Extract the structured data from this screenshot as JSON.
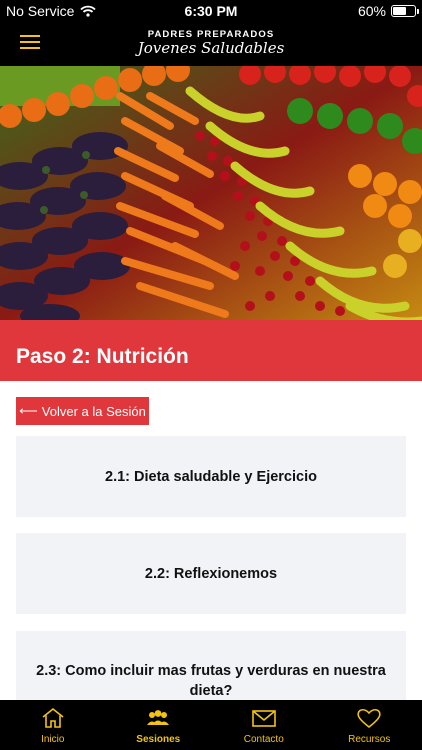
{
  "status_bar": {
    "carrier": "No Service",
    "time": "6:30 PM",
    "battery_percent": "60%",
    "battery_level": 0.6
  },
  "header": {
    "brand_line1": "PADRES PREPARADOS",
    "brand_line2": "Jovenes Saludables",
    "menu_icon": "hamburger-menu-icon"
  },
  "hero": {
    "image": "fruits-and-vegetables-market"
  },
  "section": {
    "title": "Paso 2: Nutrición"
  },
  "back_button": {
    "arrow": "⟵",
    "label": "Volver a la Sesión"
  },
  "cards": [
    {
      "label": "2.1: Dieta saludable y Ejercicio"
    },
    {
      "label": "2.2: Reflexionemos"
    },
    {
      "label": "2.3: Como incluir mas frutas y verduras en nuestra dieta?"
    }
  ],
  "tab_bar": {
    "tabs": [
      {
        "label": "Inicio",
        "icon": "home-icon"
      },
      {
        "label": "Sesiones",
        "icon": "group-icon"
      },
      {
        "label": "Contacto",
        "icon": "mail-icon"
      },
      {
        "label": "Recursos",
        "icon": "heart-icon"
      }
    ],
    "active_index": 1
  },
  "colors": {
    "accent_red": "#e0373d",
    "accent_yellow": "#f2c311",
    "card_bg": "#f1f3f7"
  }
}
